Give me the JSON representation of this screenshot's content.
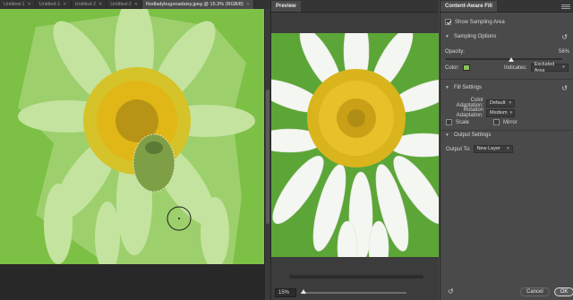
{
  "document_tabs": [
    {
      "label": "Untitled-1",
      "active": false
    },
    {
      "label": "Untitled-1",
      "active": false
    },
    {
      "label": "Untitled-2",
      "active": false
    },
    {
      "label": "Untitled-2",
      "active": false
    },
    {
      "label": "Redladybugonadaisy.jpeg @ 15.3% (RGB/8)",
      "active": true
    }
  ],
  "preview": {
    "tab_label": "Preview",
    "zoom_value": "15%",
    "zoom_level_fraction": 0.0
  },
  "content_aware_fill": {
    "tab_label": "Content-Aware Fill",
    "show_sampling_area": {
      "label": "Show Sampling Area",
      "checked": true
    },
    "sampling_options": {
      "title": "Sampling Options",
      "opacity_label": "Opacity:",
      "opacity_value": "56%",
      "opacity_fraction": 0.56,
      "color_label": "Color:",
      "color_value": "#88c25a",
      "indicates_label": "Indicates:",
      "indicates_value": "Excluded Area"
    },
    "fill_settings": {
      "title": "Fill Settings",
      "color_adaptation_label": "Color Adaptation:",
      "color_adaptation_value": "Default",
      "rotation_adaptation_label": "Rotation Adaptation:",
      "rotation_adaptation_value": "Medium",
      "scale_label": "Scale",
      "scale_checked": false,
      "mirror_label": "Mirror",
      "mirror_checked": false
    },
    "output_settings": {
      "title": "Output Settings",
      "output_to_label": "Output To:",
      "output_to_value": "New Layer"
    },
    "cancel_label": "Cancel",
    "ok_label": "OK"
  },
  "colors": {
    "sampling_overlay": "#88c25a",
    "panel_bg": "#4a4a4a"
  }
}
